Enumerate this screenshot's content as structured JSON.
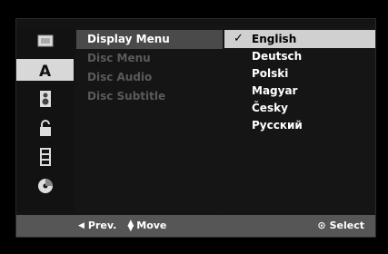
{
  "sidebar": {
    "items": [
      {
        "icon": "screen-icon"
      },
      {
        "icon": "language-icon",
        "label": "A",
        "active": true
      },
      {
        "icon": "speaker-icon"
      },
      {
        "icon": "lock-icon"
      },
      {
        "icon": "film-icon"
      },
      {
        "icon": "disc-icon"
      }
    ]
  },
  "menu": {
    "items": [
      {
        "label": "Display Menu",
        "active": true
      },
      {
        "label": "Disc Menu"
      },
      {
        "label": "Disc Audio"
      },
      {
        "label": "Disc Subtitle"
      }
    ]
  },
  "options": {
    "check_glyph": "✓",
    "items": [
      {
        "label": "English",
        "selected": true
      },
      {
        "label": "Deutsch"
      },
      {
        "label": "Polski"
      },
      {
        "label": "Magyar"
      },
      {
        "label": "Česky"
      },
      {
        "label": "Русский"
      }
    ]
  },
  "footer": {
    "prev_label": "Prev.",
    "move_label": "Move",
    "select_label": "Select"
  },
  "colors": {
    "background": "#000000",
    "panel": "#141414",
    "highlight": "#d0d0d0",
    "footer": "#565656",
    "inactive_text": "#5a5a5a"
  }
}
